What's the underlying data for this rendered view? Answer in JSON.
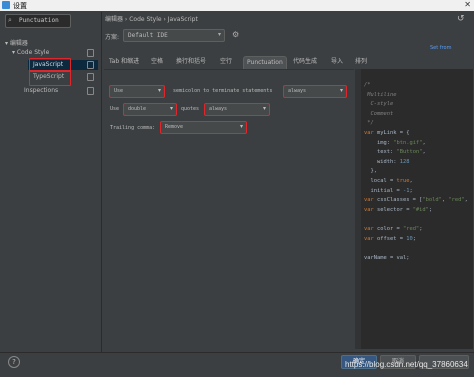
{
  "window": {
    "title": "设置"
  },
  "search": {
    "value": "Punctuation"
  },
  "tree": {
    "root": "编辑器",
    "code_style": "Code Style",
    "javascript": "JavaScript",
    "typescript": "TypeScript",
    "inspections": "Inspections"
  },
  "breadcrumb": "编辑器 › Code Style › JavaScript",
  "scheme": {
    "label": "方案:",
    "value": "Default  IDE"
  },
  "set_from": "Set from",
  "tabs": [
    "Tab 和缩进",
    "空格",
    "换行和括号",
    "空行",
    "Punctuation",
    "代码生成",
    "导入",
    "排列"
  ],
  "punctuation": {
    "row1": {
      "use_value": "Use",
      "middle_text": "semicolon to terminate statements",
      "when_value": "always"
    },
    "row2": {
      "use_label": "Use",
      "quote_value": "double",
      "quotes_label": "quotes",
      "when_value": "always"
    },
    "row3": {
      "label": "Trailing comma:",
      "value": "Remove"
    }
  },
  "code_preview": [
    [
      [
        "c-com",
        "/*"
      ]
    ],
    [
      [
        "c-com",
        " Multiline"
      ]
    ],
    [
      [
        "c-com",
        "  C-style"
      ]
    ],
    [
      [
        "c-com",
        "  Comment"
      ]
    ],
    [
      [
        "c-com",
        " */"
      ]
    ],
    [
      [
        "c-kw",
        "var "
      ],
      [
        "c-id",
        "myLink = {"
      ]
    ],
    [
      [
        "c-id",
        "    img: "
      ],
      [
        "c-str",
        "\"btn.gif\""
      ],
      [
        "c-id",
        ","
      ]
    ],
    [
      [
        "c-id",
        "    text: "
      ],
      [
        "c-str",
        "\"Button\""
      ],
      [
        "c-id",
        ","
      ]
    ],
    [
      [
        "c-id",
        "    width: "
      ],
      [
        "c-num",
        "128"
      ]
    ],
    [
      [
        "c-id",
        "  },"
      ]
    ],
    [
      [
        "c-id",
        "  local = "
      ],
      [
        "c-kw",
        "true"
      ],
      [
        "c-id",
        ","
      ]
    ],
    [
      [
        "c-id",
        "  initial = "
      ],
      [
        "c-num",
        "-1"
      ],
      [
        "c-id",
        ";"
      ]
    ],
    [
      [
        "c-kw",
        "var "
      ],
      [
        "c-id",
        "cssClasses = ["
      ],
      [
        "c-str",
        "\"bold\""
      ],
      [
        "c-id",
        ", "
      ],
      [
        "c-str",
        "\"red\""
      ],
      [
        "c-id",
        ","
      ]
    ],
    [
      [
        "c-kw",
        "var "
      ],
      [
        "c-id",
        "selector = "
      ],
      [
        "c-str",
        "\"#id\""
      ],
      [
        "c-id",
        ";"
      ]
    ],
    [],
    [
      [
        "c-kw",
        "var "
      ],
      [
        "c-id",
        "color = "
      ],
      [
        "c-str",
        "\"red\""
      ],
      [
        "c-id",
        ";"
      ]
    ],
    [
      [
        "c-kw",
        "var "
      ],
      [
        "c-id",
        "offset = "
      ],
      [
        "c-num",
        "10"
      ],
      [
        "c-id",
        ";"
      ]
    ],
    [],
    [
      [
        "c-id",
        "varName = val;"
      ]
    ]
  ],
  "buttons": {
    "ok": "确定",
    "cancel": "取消"
  },
  "help": "?",
  "watermark": "https://blog.csdn.net/qq_37860634"
}
